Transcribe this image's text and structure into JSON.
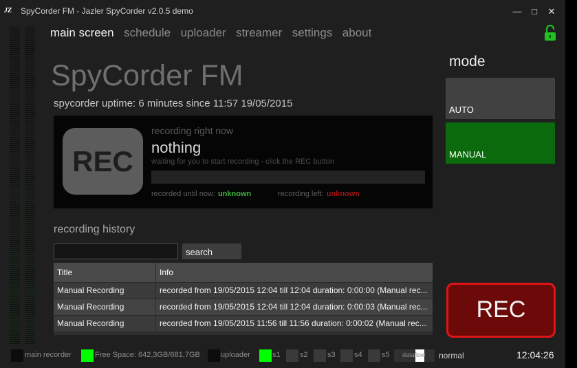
{
  "window": {
    "app_icon_text": "JZ",
    "title": "SpyCorder FM - Jazler SpyCorder v2.0.5 demo"
  },
  "nav": {
    "items": [
      {
        "label": "main screen",
        "active": true
      },
      {
        "label": "schedule",
        "active": false
      },
      {
        "label": "uploader",
        "active": false
      },
      {
        "label": "streamer",
        "active": false
      },
      {
        "label": "settings",
        "active": false
      },
      {
        "label": "about",
        "active": false
      }
    ],
    "lock_icon": "unlocked-padlock-icon"
  },
  "main": {
    "station_title": "SpyCorder FM",
    "uptime": "spycorder uptime: 6 minutes since 11:57 19/05/2015"
  },
  "recording": {
    "icon_text": "REC",
    "heading": "recording right now",
    "current": "nothing",
    "hint": "waiting for you to start recording - click the REC button",
    "recorded_label": "recorded until now:",
    "recorded_value": "unknown",
    "left_label": "recording left:",
    "left_value": "unknown"
  },
  "history": {
    "title": "recording history",
    "search_value": "",
    "search_button": "search",
    "columns": [
      "Title",
      "Info"
    ],
    "rows": [
      {
        "title": "Manual Recording",
        "info": "recorded from 19/05/2015 12:04 till 12:04 duration: 0:00:00 (Manual rec..."
      },
      {
        "title": "Manual Recording",
        "info": "recorded from 19/05/2015 12:04 till 12:04 duration: 0:00:03 (Manual rec..."
      },
      {
        "title": "Manual Recording",
        "info": "recorded from 19/05/2015 11:56 till 11:56 duration: 0:00:02 (Manual rec..."
      }
    ]
  },
  "mode": {
    "title": "mode",
    "auto_label": "AUTO",
    "manual_label": "MANUAL",
    "selected": "MANUAL"
  },
  "rec_button": "REC",
  "status": {
    "main_recorder": "main recorder",
    "free_space": "Free Space: 642,3GB/681,7GB",
    "uploader": "uploader",
    "s1": "s1",
    "s2": "s2",
    "s3": "s3",
    "s4": "s4",
    "s5": "s5",
    "dataflow": "dataflow",
    "mode_text": "normal",
    "clock": "12:04:26"
  },
  "colors": {
    "accent_green": "#0b6a0b",
    "rec_red": "#df1515",
    "indicator_green": "#00ff00"
  }
}
